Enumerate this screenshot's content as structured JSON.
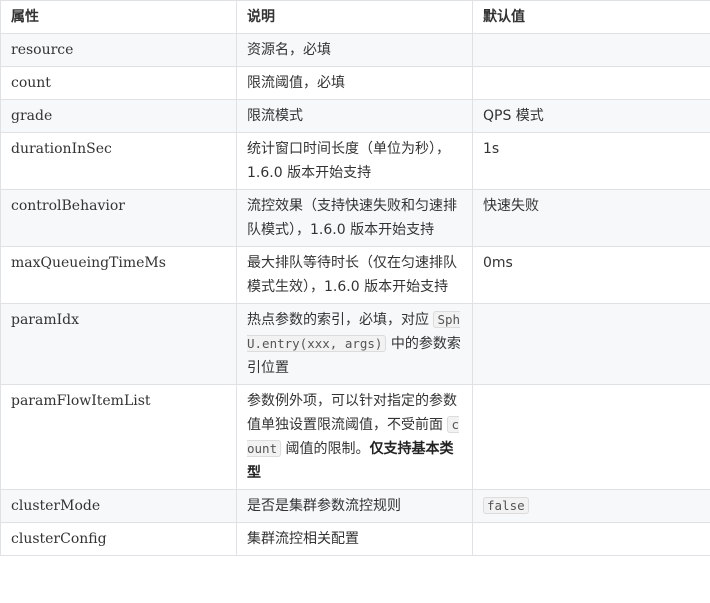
{
  "table": {
    "headers": [
      "属性",
      "说明",
      "默认值"
    ],
    "rows": [
      {
        "name": "resource",
        "desc": "资源名，必填",
        "default": ""
      },
      {
        "name": "count",
        "desc": "限流阈值，必填",
        "default": ""
      },
      {
        "name": "grade",
        "desc": "限流模式",
        "default": "QPS 模式"
      },
      {
        "name": "durationInSec",
        "desc": "统计窗口时间长度（单位为秒），1.6.0 版本开始支持",
        "default": "1s"
      },
      {
        "name": "controlBehavior",
        "desc": "流控效果（支持快速失败和匀速排队模式），1.6.0 版本开始支持",
        "default": "快速失败"
      },
      {
        "name": "maxQueueingTimeMs",
        "desc": "最大排队等待时长（仅在匀速排队模式生效），1.6.0 版本开始支持",
        "default": "0ms"
      },
      {
        "name": "paramIdx",
        "desc_before": "热点参数的索引，必填，对应 ",
        "desc_code": "SphU.entry(xxx, args)",
        "desc_after": " 中的参数索引位置",
        "default": ""
      },
      {
        "name": "paramFlowItemList",
        "desc_before": "参数例外项，可以针对指定的参数值单独设置限流阈值，不受前面 ",
        "desc_code": "count",
        "desc_after": " 阈值的限制。",
        "desc_strong": "仅支持基本类型",
        "default": ""
      },
      {
        "name": "clusterMode",
        "desc": "是否是集群参数流控规则",
        "default_code": "false"
      },
      {
        "name": "clusterConfig",
        "desc": "集群流控相关配置",
        "default": ""
      }
    ]
  }
}
